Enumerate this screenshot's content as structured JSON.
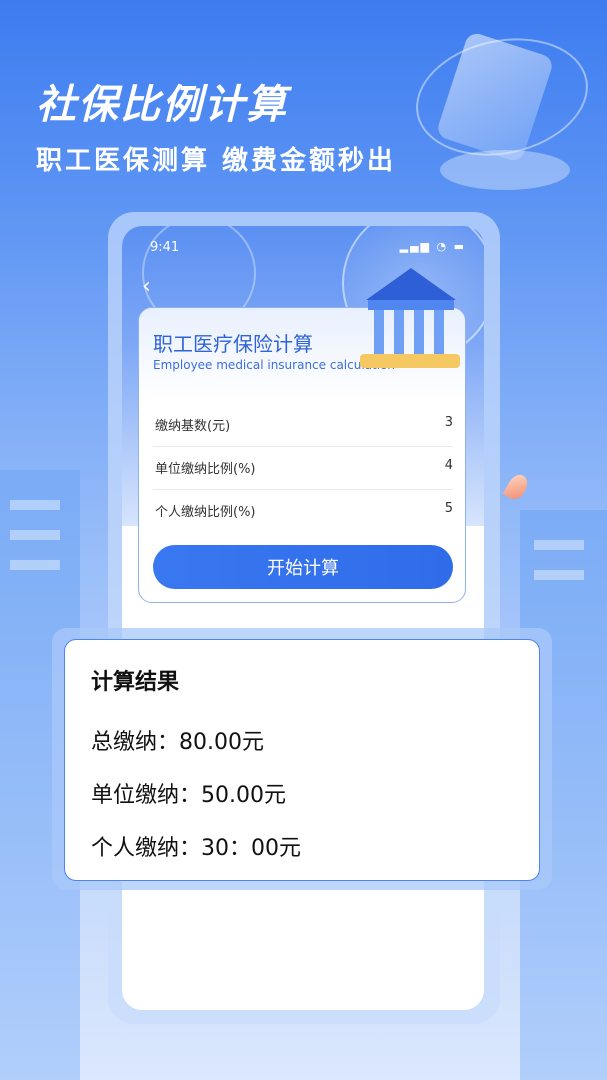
{
  "promo": {
    "headline": "社保比例计算",
    "subline": "职工医保测算 缴费金额秒出"
  },
  "status_bar": {
    "time": "9:41",
    "icons": "▂▄▆ ◔ ▬"
  },
  "nav": {
    "back_icon": "‹"
  },
  "calculator": {
    "title": "职工医疗保险计算",
    "subtitle": "Employee medical insurance calculation",
    "fields": [
      {
        "label": "缴纳基数(元)",
        "value": "3"
      },
      {
        "label": "单位缴纳比例(%)",
        "value": "4"
      },
      {
        "label": "个人缴纳比例(%)",
        "value": "5"
      }
    ],
    "button_label": "开始计算"
  },
  "result": {
    "title": "计算结果",
    "lines": [
      "总缴纳：80.00元",
      "单位缴纳：50.00元",
      "个人缴纳：30：00元"
    ]
  },
  "colors": {
    "accent": "#2f6cea",
    "title_blue": "#2f63d8"
  }
}
